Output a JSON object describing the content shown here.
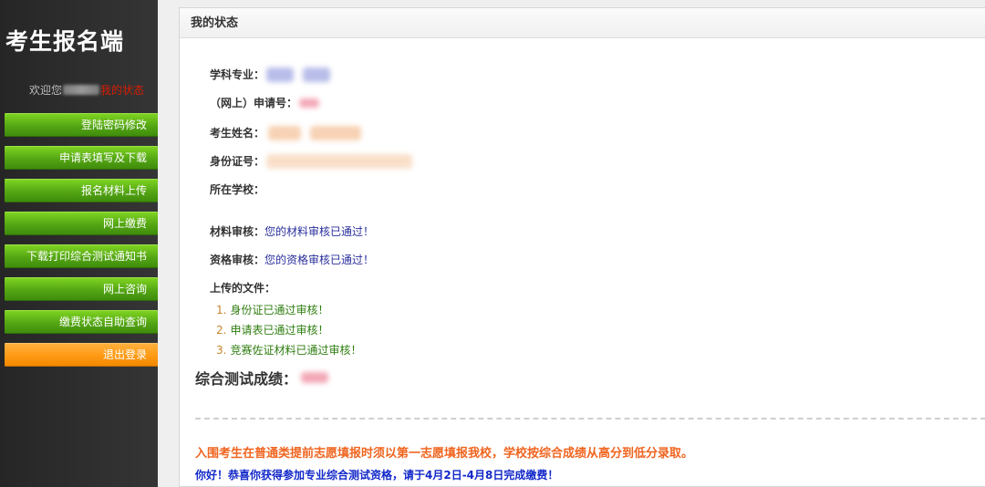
{
  "sidebar": {
    "brand": "考生报名端",
    "welcome_prefix": "欢迎您",
    "welcome_status": "我的状态",
    "nav": [
      {
        "label": "登陆密码修改"
      },
      {
        "label": "申请表填写及下载"
      },
      {
        "label": "报名材料上传"
      },
      {
        "label": "网上缴费"
      },
      {
        "label": "下载打印综合测试通知书"
      },
      {
        "label": "网上咨询"
      },
      {
        "label": "缴费状态自助查询"
      },
      {
        "label": "退出登录"
      }
    ]
  },
  "panel": {
    "title": "我的状态",
    "fields": {
      "major_label": "学科专业：",
      "app_no_label": "（网上）申请号：",
      "name_label": "考生姓名：",
      "id_label": "身份证号：",
      "school_label": "所在学校：",
      "material_label": "材料审核：",
      "material_value": "您的材料审核已通过！",
      "qualification_label": "资格审核：",
      "qualification_value": "您的资格审核已通过！"
    },
    "files": {
      "title": "上传的文件：",
      "items": [
        {
          "num": "1.",
          "text": "身份证已通过审核！"
        },
        {
          "num": "2.",
          "text": "申请表已通过审核！"
        },
        {
          "num": "3.",
          "text": "竞赛佐证材料已通过审核！"
        }
      ]
    },
    "score_label": "综合测试成绩：",
    "notice_orange": "入围考生在普通类提前志愿填报时须以第一志愿填报我校，学校按综合成绩从高分到低分录取。",
    "notice_blue": "你好！恭喜你获得参加专业综合测试资格，请于4月2日-4月8日完成缴费！"
  },
  "colors": {
    "nav_green": "#54a614",
    "nav_orange": "#ff9a14",
    "status_red": "#d81e06",
    "notice_orange": "#f0641e",
    "notice_blue": "#1228c9",
    "pass_blue": "#2a2f9c",
    "file_green": "#2e7d0f"
  }
}
